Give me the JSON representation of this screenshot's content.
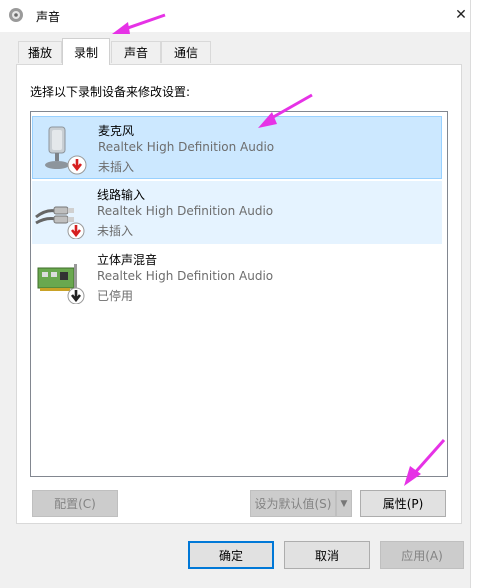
{
  "window": {
    "title": "声音",
    "close_glyph": "✕"
  },
  "tabs": [
    {
      "label": "播放"
    },
    {
      "label": "录制"
    },
    {
      "label": "声音"
    },
    {
      "label": "通信"
    }
  ],
  "instruction": "选择以下录制设备来修改设置:",
  "devices": [
    {
      "name": "麦克风",
      "driver": "Realtek High Definition Audio",
      "status": "未插入",
      "icon": "microphone-icon",
      "selected": true
    },
    {
      "name": "线路输入",
      "driver": "Realtek High Definition Audio",
      "status": "未插入",
      "icon": "line-in-cable-icon",
      "selected": false
    },
    {
      "name": "立体声混音",
      "driver": "Realtek High Definition Audio",
      "status": "已停用",
      "icon": "sound-card-icon",
      "selected": false
    }
  ],
  "buttons": {
    "configure": "配置(C)",
    "set_default": "设为默认值(S)",
    "properties": "属性(P)",
    "ok": "确定",
    "cancel": "取消",
    "apply": "应用(A)"
  },
  "colors": {
    "selection": "#cce8ff",
    "accent": "#0078d7",
    "annotation": "#e632e6"
  }
}
